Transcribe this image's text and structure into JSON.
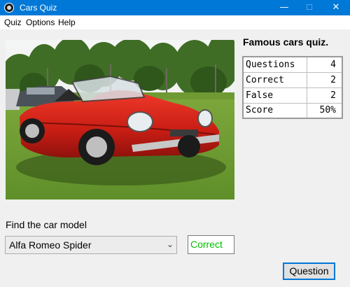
{
  "window": {
    "title": "Cars Quiz",
    "minimize_glyph": "—",
    "maximize_glyph": "☐",
    "close_glyph": "✕",
    "icon": "app-icon"
  },
  "menu": [
    "Quiz",
    "Options",
    "Help"
  ],
  "image": {
    "icon": "car-photo",
    "subject": "red convertible on grass"
  },
  "stats": {
    "title": "Famous cars quiz.",
    "rows": [
      {
        "label": "Questions",
        "value": "4"
      },
      {
        "label": "Correct",
        "value": "2"
      },
      {
        "label": "False",
        "value": "2"
      },
      {
        "label": "Score",
        "value": "50%"
      }
    ]
  },
  "find": {
    "label": "Find the car model",
    "selected": "Alfa Romeo Spider",
    "chevron_icon": "chevron-down-icon"
  },
  "result": {
    "text": "Correct",
    "color": "#00c000"
  },
  "question_button": "Question",
  "colors": {
    "titlebar": "#0078d7",
    "focus_border": "#0078d7"
  }
}
